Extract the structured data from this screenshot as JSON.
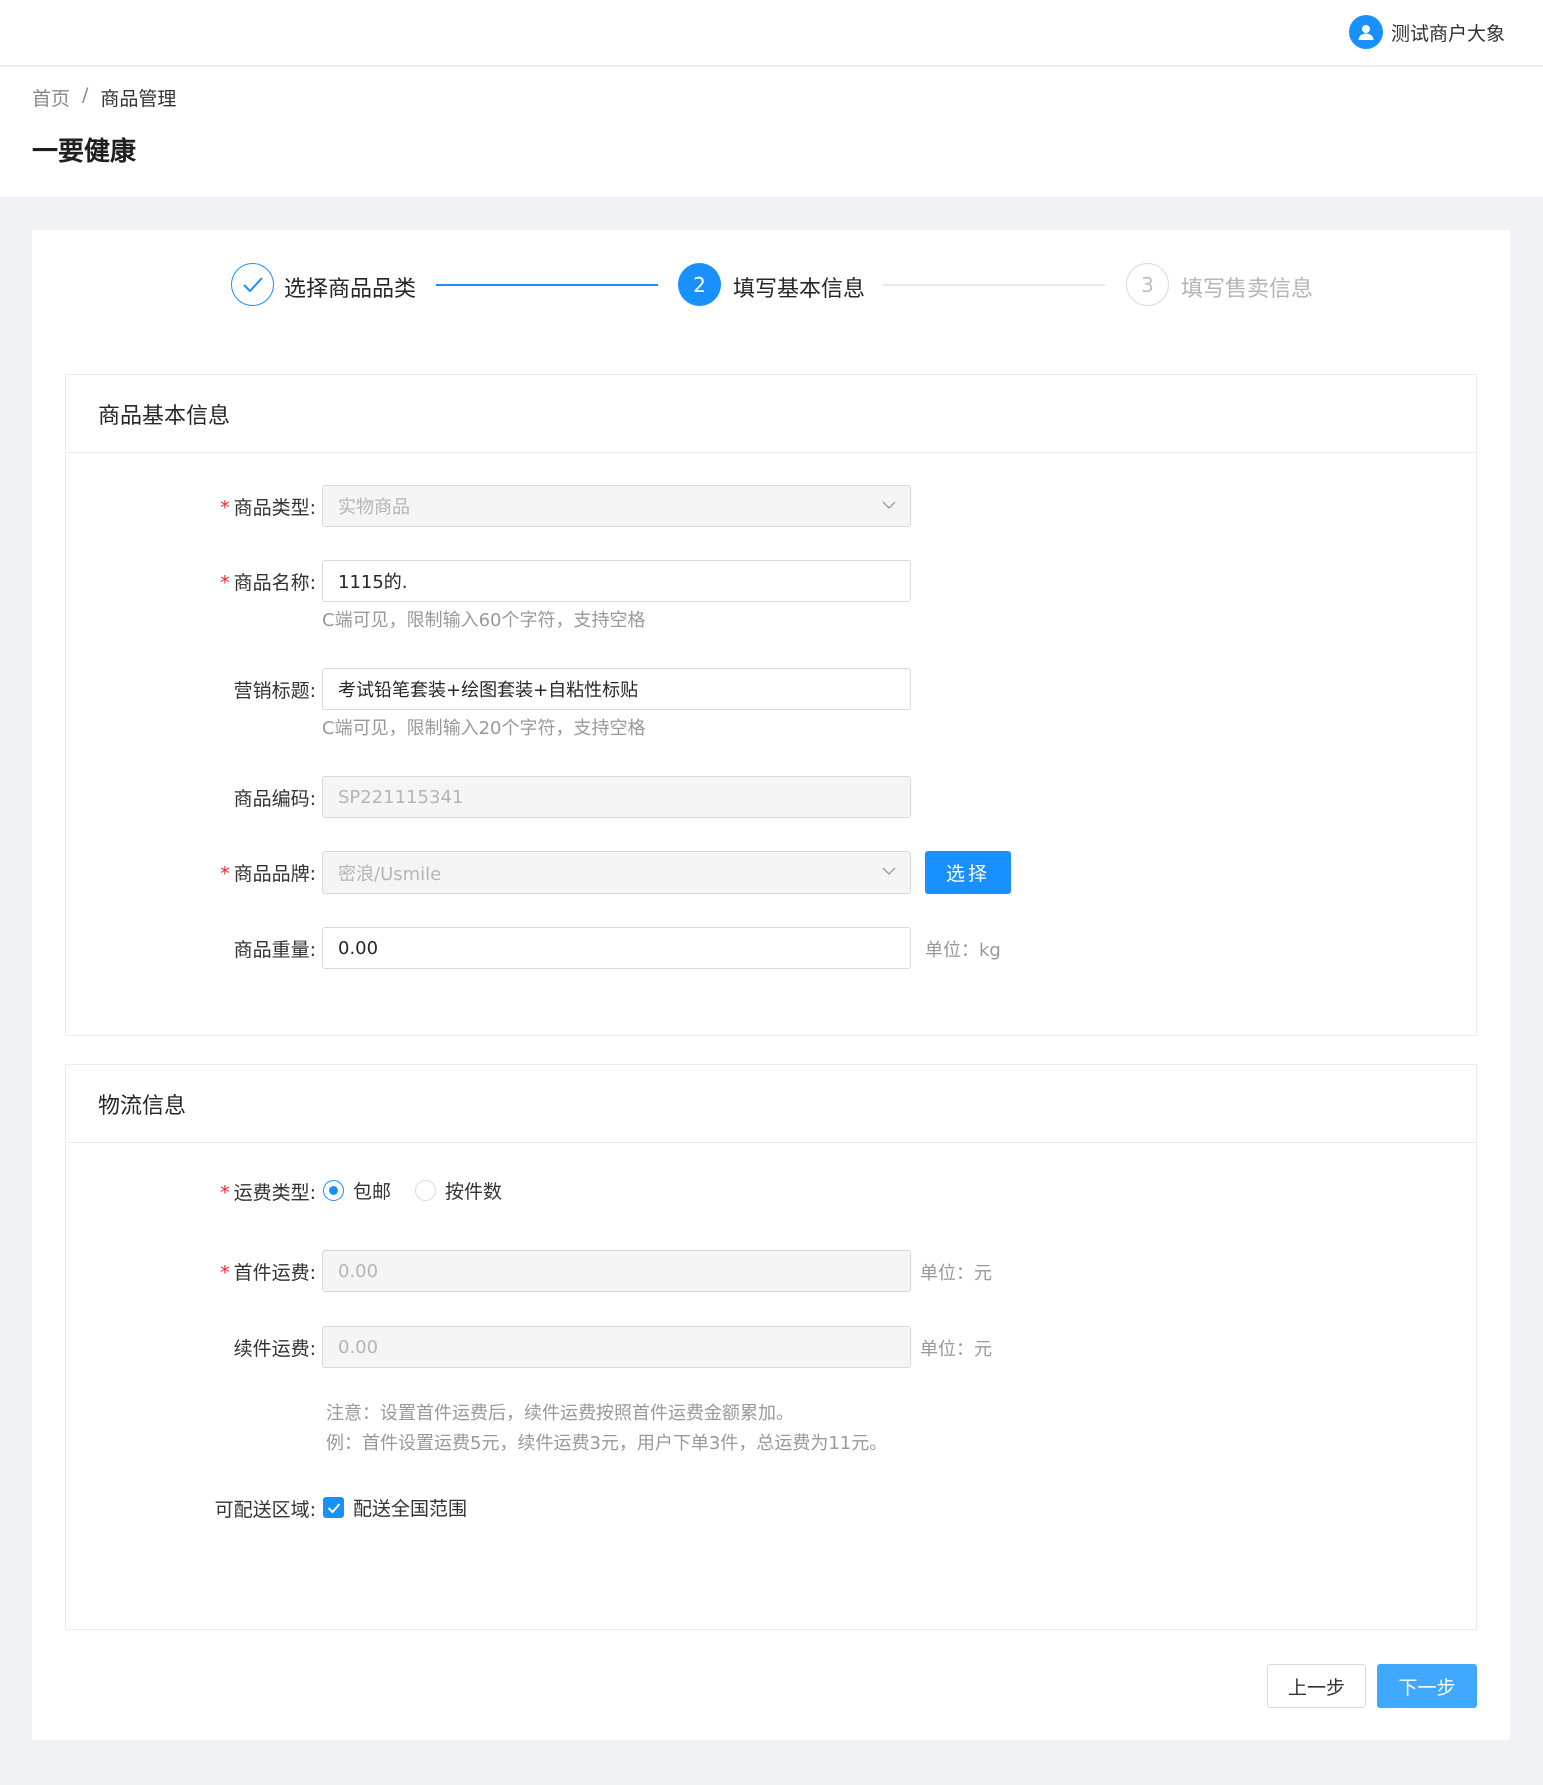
{
  "header": {
    "user_name": "测试商户大象",
    "breadcrumb": {
      "home": "首页",
      "separator": "/",
      "current": "商品管理"
    },
    "title": "一要健康"
  },
  "steps": [
    {
      "index": "1",
      "label": "选择商品品类",
      "status": "done"
    },
    {
      "index": "2",
      "label": "填写基本信息",
      "status": "active"
    },
    {
      "index": "3",
      "label": "填写售卖信息",
      "status": "wait"
    }
  ],
  "basic_info": {
    "title": "商品基本信息",
    "product_type": {
      "label": "商品类型:",
      "value": "实物商品"
    },
    "product_name": {
      "label": "商品名称:",
      "value": "1115的.",
      "hint": "C端可见，限制输入60个字符，支持空格"
    },
    "marketing_title": {
      "label": "营销标题:",
      "value": "考试铅笔套装+绘图套装+自粘性标贴",
      "hint": "C端可见，限制输入20个字符，支持空格"
    },
    "product_code": {
      "label": "商品编码:",
      "value": "SP221115341"
    },
    "brand": {
      "label": "商品品牌:",
      "value": "密浪/Usmile",
      "button": "选择"
    },
    "weight": {
      "label": "商品重量:",
      "value": "0.00",
      "unit": "单位：kg"
    }
  },
  "logistics": {
    "title": "物流信息",
    "freight_type": {
      "label": "运费类型:",
      "options": [
        "包邮",
        "按件数"
      ],
      "selected": "包邮"
    },
    "first_fee": {
      "label": "首件运费:",
      "value": "0.00",
      "unit": "单位：元"
    },
    "extra_fee": {
      "label": "续件运费:",
      "value": "0.00",
      "unit": "单位：元"
    },
    "note_line1": "注意：设置首件运费后，续件运费按照首件运费金额累加。",
    "note_line2": "例：首件设置运费5元，续件运费3元，用户下单3件，总运费为11元。",
    "region": {
      "label": "可配送区域:",
      "checkbox_label": "配送全国范围",
      "checked": true
    }
  },
  "footer": {
    "prev": "上一步",
    "next": "下一步"
  },
  "colors": {
    "primary": "#1890ff",
    "required": "#f5222d",
    "next_button": "#40a9ff"
  }
}
